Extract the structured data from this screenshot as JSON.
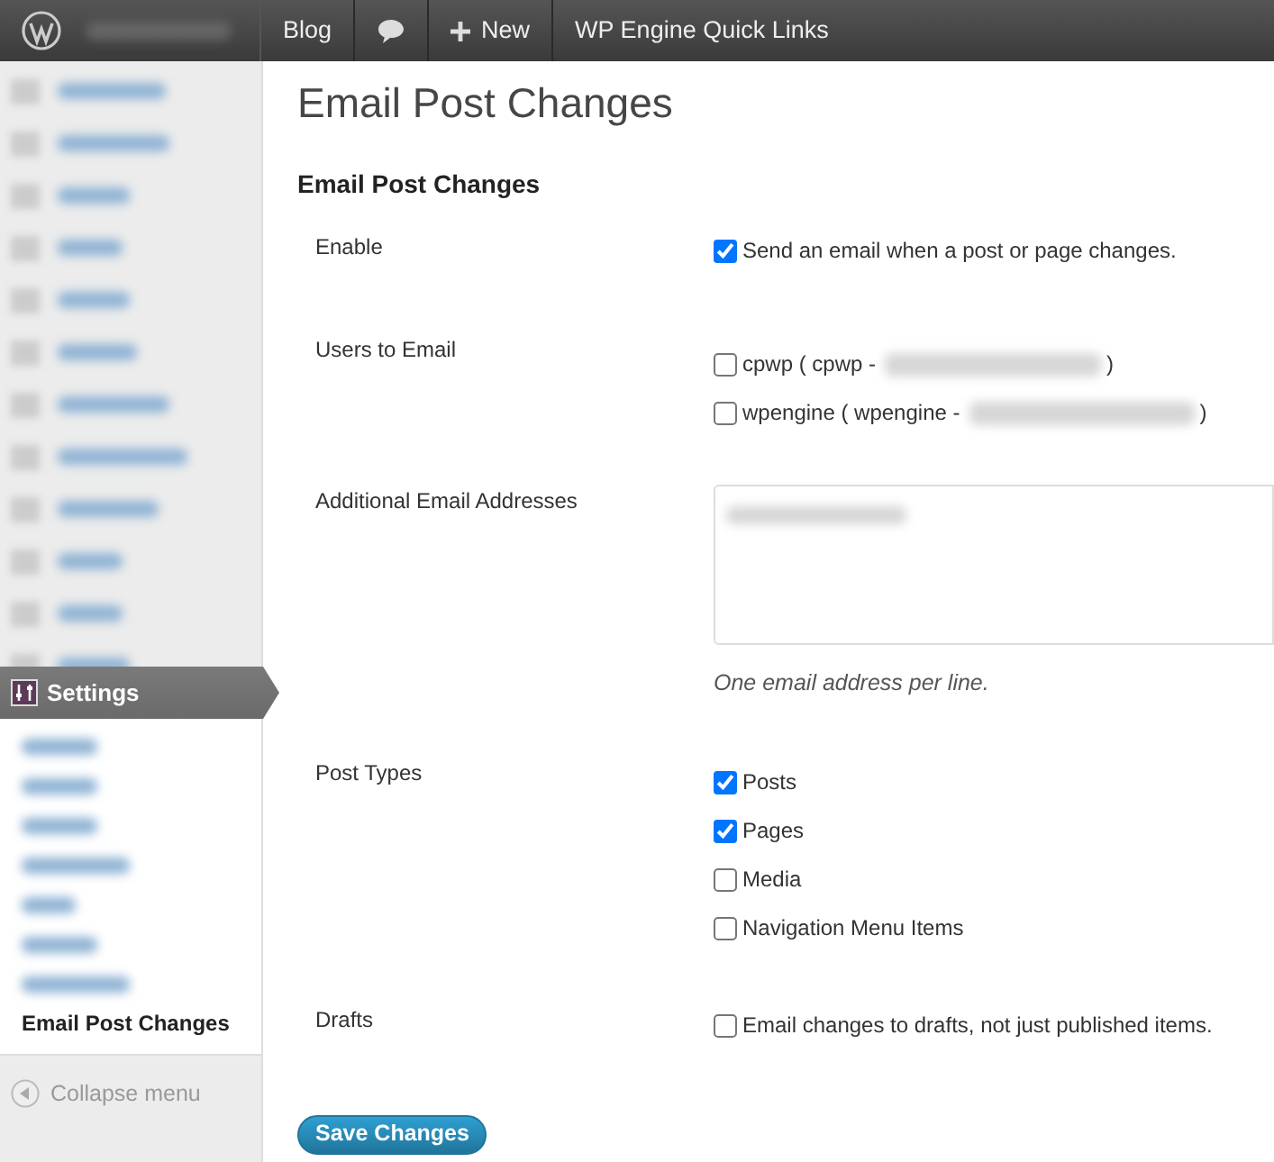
{
  "admin_bar": {
    "items": [
      {
        "kind": "text",
        "label": "Blog"
      },
      {
        "kind": "comments"
      },
      {
        "kind": "new",
        "label": "New"
      },
      {
        "kind": "text",
        "label": "WP Engine Quick Links"
      }
    ]
  },
  "sidebar": {
    "menu_header": "Settings",
    "submenu": [
      {
        "kind": "blurred"
      },
      {
        "kind": "blurred"
      },
      {
        "kind": "blurred"
      },
      {
        "kind": "blurred"
      },
      {
        "kind": "blurred"
      },
      {
        "kind": "blurred"
      },
      {
        "kind": "blurred"
      },
      {
        "kind": "link",
        "label": "Email Post Changes",
        "selected": true
      }
    ],
    "collapse": "Collapse menu"
  },
  "page": {
    "title": "Email Post Changes",
    "section_title": "Email Post Changes",
    "fields": [
      {
        "kind": "checks",
        "label": "Enable",
        "options": [
          {
            "label": "Send an email when a post or page changes.",
            "checked": true
          }
        ]
      },
      {
        "kind": "users",
        "label": "Users to Email",
        "options": [
          {
            "label": "cpwp ( cpwp -",
            "suffix": ")",
            "checked": false
          },
          {
            "label": "wpengine ( wpengine -",
            "suffix": ")",
            "checked": false
          }
        ]
      },
      {
        "kind": "textarea",
        "label": "Additional Email Addresses",
        "hint": "One email address per line."
      },
      {
        "kind": "checks",
        "label": "Post Types",
        "options": [
          {
            "label": "Posts",
            "checked": true
          },
          {
            "label": "Pages",
            "checked": true
          },
          {
            "label": "Media",
            "checked": false
          },
          {
            "label": "Navigation Menu Items",
            "checked": false
          }
        ]
      },
      {
        "kind": "checks",
        "label": "Drafts",
        "options": [
          {
            "label": "Email changes to drafts, not just published items.",
            "checked": false
          }
        ]
      }
    ],
    "save_button": "Save Changes"
  }
}
